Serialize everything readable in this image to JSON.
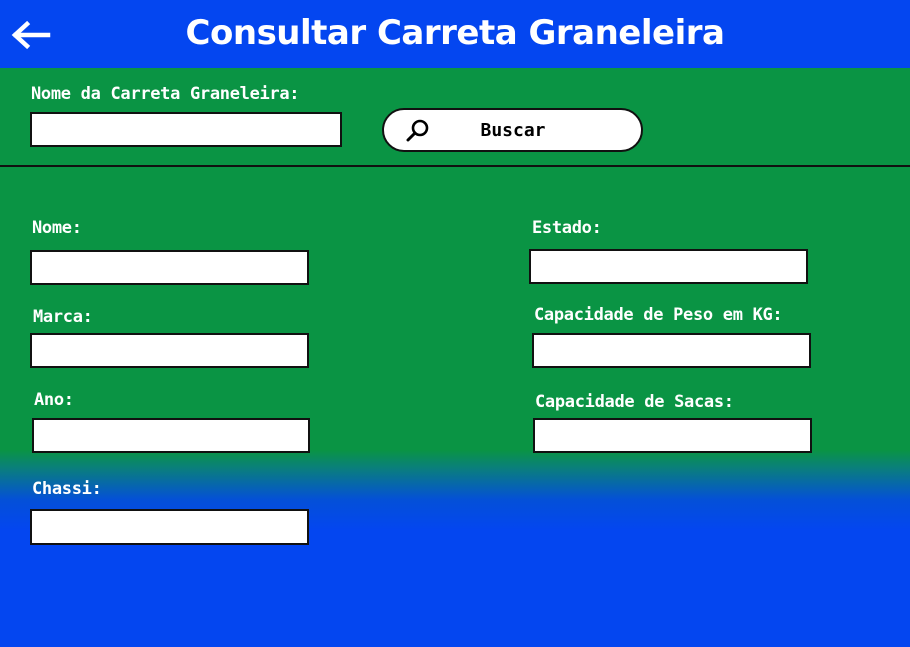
{
  "header": {
    "title": "Consultar Carreta Graneleira",
    "back_icon": "arrow-left-icon"
  },
  "search": {
    "label": "Nome da Carreta Graneleira:",
    "value": "",
    "button_label": "Buscar",
    "button_icon": "search-icon"
  },
  "form": {
    "nome": {
      "label": "Nome:",
      "value": ""
    },
    "marca": {
      "label": "Marca:",
      "value": ""
    },
    "ano": {
      "label": "Ano:",
      "value": ""
    },
    "chassi": {
      "label": "Chassi:",
      "value": ""
    },
    "estado": {
      "label": "Estado:",
      "value": ""
    },
    "capacidade_peso": {
      "label": "Capacidade de Peso em KG:",
      "value": ""
    },
    "capacidade_sacas": {
      "label": "Capacidade de Sacas:",
      "value": ""
    }
  },
  "colors": {
    "header_bg": "#0446f0",
    "body_green": "#0a9444",
    "body_blue": "#0446f0",
    "text": "#ffffff"
  }
}
